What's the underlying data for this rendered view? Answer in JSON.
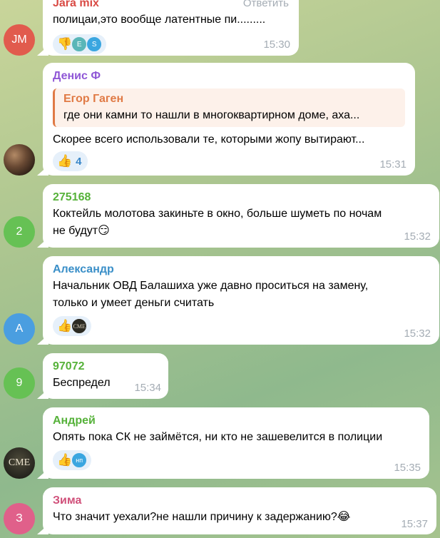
{
  "messages": [
    {
      "avatar_initials": "JM",
      "avatar_color": "#e15b4d",
      "sender": "Jara mix",
      "sender_color": "#d94a44",
      "header_right": "Ответить",
      "text": "полицаи,это вообще латентные пи.........",
      "reactions": [
        {
          "icon": "thumbs-down-icon",
          "emoji": "👎"
        }
      ],
      "time": "15:30"
    },
    {
      "sender": "Денис Ф",
      "sender_color": "#8f57d6",
      "reply": {
        "name": "Егор Гаген",
        "text": "где они камни то нашли в многоквартирном доме, аха..."
      },
      "text": "Скорее всего использовали те, которыми жопу вытирают...",
      "reactions": [
        {
          "icon": "thumbs-up-icon",
          "emoji": "👍",
          "count": "4"
        }
      ],
      "time": "15:31"
    },
    {
      "avatar_initials": "2",
      "avatar_color": "#66c154",
      "sender": "275168",
      "sender_color": "#56b23a",
      "lines": [
        "Коктейль молотова закиньте в окно, больше шуметь по ночам",
        "не будут😏"
      ],
      "time": "15:32"
    },
    {
      "avatar_initials": "A",
      "avatar_color": "#4a9ee0",
      "sender": "Александр",
      "sender_color": "#3a8fc8",
      "lines": [
        "Начальник ОВД Балашиха уже давно проситься на замену,",
        "только и умеет деньги считать"
      ],
      "reactions": [
        {
          "icon": "thumbs-up-icon",
          "emoji": "👍"
        }
      ],
      "time": "15:32"
    },
    {
      "avatar_initials": "9",
      "avatar_color": "#66c154",
      "sender": "97072",
      "sender_color": "#56b23a",
      "text": "Беспредел",
      "time": "15:34"
    },
    {
      "avatar_initials": "CME",
      "sender": "Андрей",
      "sender_color": "#56b23a",
      "text": "Опять пока СК не займётся, ни кто не зашевелится в полиции",
      "reactions": [
        {
          "icon": "thumbs-up-icon",
          "emoji": "👍",
          "mini": "нп"
        }
      ],
      "time": "15:35"
    },
    {
      "avatar_initials": "З",
      "avatar_color": "#e0608a",
      "sender": "Зима",
      "sender_color": "#d0507a",
      "text": "Что значит уехали?не нашли причину к задержанию?😂",
      "time": "15:37"
    }
  ],
  "mini_avatar_cme": "CME"
}
